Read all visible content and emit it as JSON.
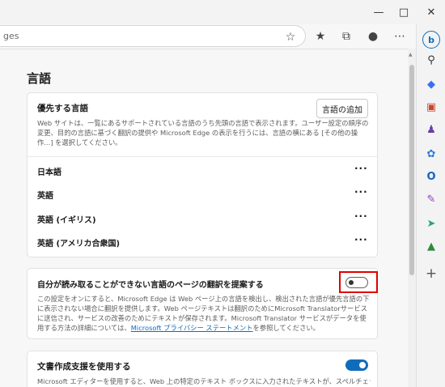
{
  "address": {
    "url_fragment": "ges"
  },
  "page": {
    "title": "言語"
  },
  "preferred": {
    "title": "優先する言語",
    "add_button": "言語の追加",
    "desc": "Web サイトは、一覧にあるサポートされている言語のうち先頭の言語で表示されます。ユーザー設定の順序の変更、目的の言語に基づく翻訳の提供や Microsoft Edge の表示を行うには、言語の横にある [その他の操作...] を選択してください。",
    "languages": [
      "日本語",
      "英語",
      "英語 (イギリス)",
      "英語 (アメリカ合衆国)"
    ],
    "more_label": "···"
  },
  "translate": {
    "title": "自分が読み取ることができない言語のページの翻訳を提案する",
    "desc": "この設定をオンにすると、Microsoft Edge は Web ページ上の言語を検出し、検出された言語が優先言語の下に表示されない場合に翻訳を提供します。Web ページテキストは翻訳のためにMicrosoft Translatorサービスに送信され、サービスの改善のためにテキストが保存されます。Microsoft Translator サービスがデータを使用する方法の詳細については、",
    "link": "Microsoft プライバシー ステートメント",
    "desc_tail": "を参照してください。",
    "enabled": false
  },
  "writing": {
    "title": "文書作成支援を使用する",
    "desc": "Microsoft エディターを使用すると、Web 上の特定のテキスト ボックスに入力されたテキストが、スペルチェック、文書校",
    "enabled": true
  },
  "colors": {
    "accent": "#0f6cbd",
    "highlight": "#e00000"
  }
}
